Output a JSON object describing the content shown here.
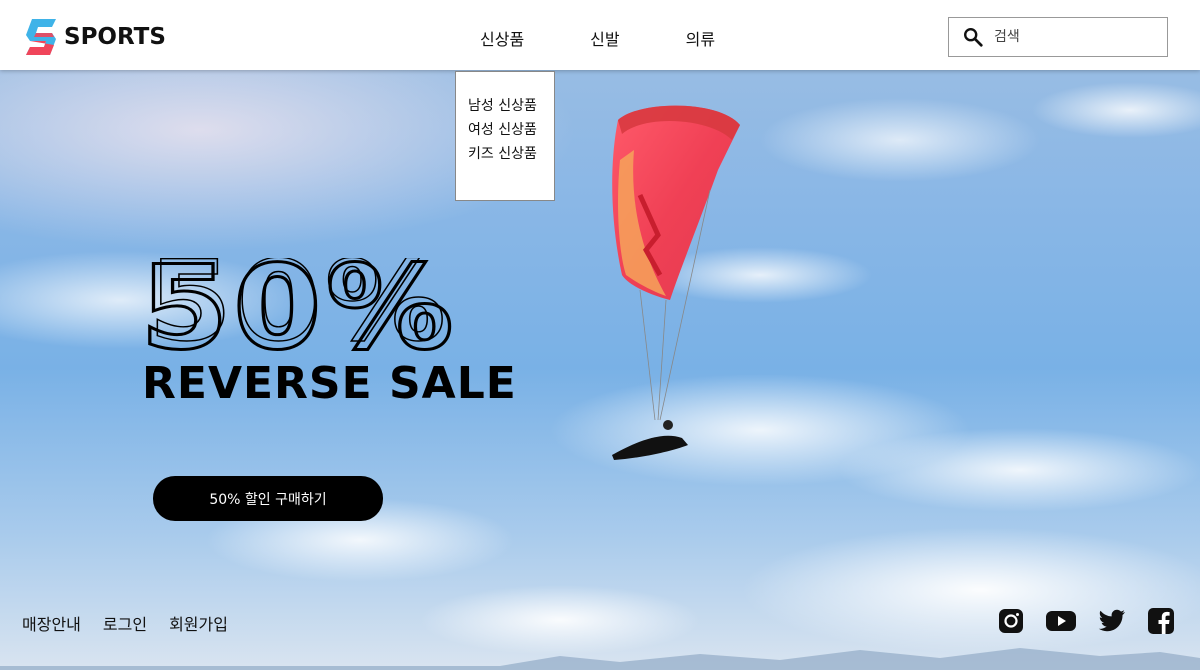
{
  "header": {
    "logo_text": "SPORTS",
    "nav": [
      {
        "label": "신상품"
      },
      {
        "label": "신발"
      },
      {
        "label": "의류"
      }
    ],
    "search": {
      "placeholder": "검색",
      "icon": "search-icon"
    }
  },
  "dropdown": {
    "items": [
      {
        "label": "남성 신상품"
      },
      {
        "label": "여성 신상품"
      },
      {
        "label": "키즈 신상품"
      }
    ]
  },
  "hero": {
    "percent": "50%",
    "title": "REVERSE SALE",
    "cta_label": "50% 할인 구매하기"
  },
  "footer": {
    "links": [
      {
        "label": "매장안내"
      },
      {
        "label": "로그인"
      },
      {
        "label": "회원가입"
      }
    ],
    "social": [
      "instagram-icon",
      "youtube-icon",
      "twitter-icon",
      "facebook-icon"
    ]
  },
  "colors": {
    "logo_red": "#f0455a",
    "logo_blue": "#3fb3e8",
    "cta_bg": "#000000",
    "cta_text": "#ffffff"
  }
}
